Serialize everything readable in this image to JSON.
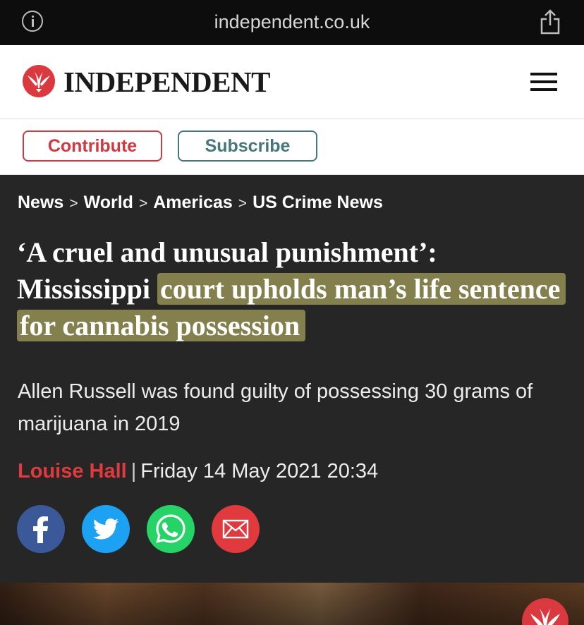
{
  "browser": {
    "url": "independent.co.uk",
    "info_icon": "info-icon",
    "share_icon": "share-icon"
  },
  "header": {
    "logo_text": "INDEPENDENT",
    "logo_icon": "eagle-logo-icon",
    "menu_icon": "hamburger-menu-icon"
  },
  "actions": {
    "contribute_label": "Contribute",
    "subscribe_label": "Subscribe"
  },
  "breadcrumb": [
    "News",
    "World",
    "Americas",
    "US Crime News"
  ],
  "breadcrumb_separator": ">",
  "article": {
    "headline_part1": "‘A cruel and unusual punishment’: Mississippi",
    "headline_highlight": "court upholds man’s life sentence for cannabis possession",
    "standfirst": "Allen Russell was found guilty of possessing 30 grams of marijuana in 2019",
    "author": "Louise Hall",
    "byline_divider": "|",
    "date": "Friday 14 May 2021 20:34"
  },
  "share_buttons": [
    {
      "name": "facebook",
      "icon": "facebook-icon",
      "color": "#3b5998"
    },
    {
      "name": "twitter",
      "icon": "twitter-icon",
      "color": "#1da1f2"
    },
    {
      "name": "whatsapp",
      "icon": "whatsapp-icon",
      "color": "#25d366"
    },
    {
      "name": "email",
      "icon": "email-icon",
      "color": "#e0393e"
    }
  ],
  "colors": {
    "brand_red": "#d1383f",
    "subscribe_teal": "#47777c",
    "article_bg": "#262626",
    "highlight": "#d0ca70"
  }
}
